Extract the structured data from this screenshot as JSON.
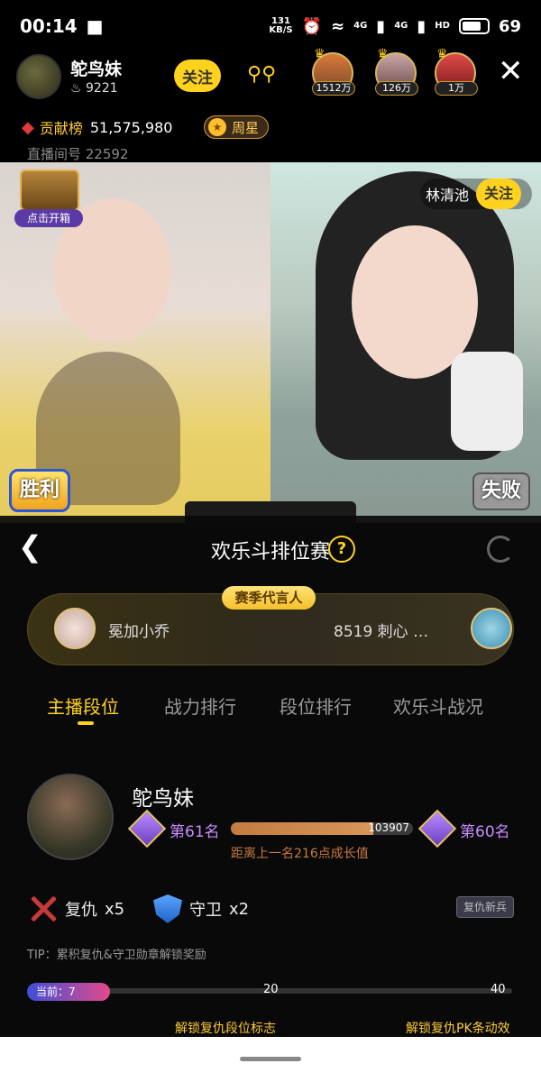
{
  "status": {
    "time": "00:14",
    "net_speed_top": "131",
    "net_speed_unit": "KB/S",
    "signal1": "4G",
    "signal2": "4G",
    "hd": "HD",
    "battery": "69"
  },
  "header": {
    "host_name": "鸵鸟妹",
    "fans": "9221",
    "follow_label": "关注",
    "viewers": [
      {
        "count": "1512万"
      },
      {
        "count": "126万"
      },
      {
        "count": "1万"
      }
    ]
  },
  "contrib": {
    "label": "贡献榜",
    "value": "51,575,980",
    "weekstar": "周星",
    "room_id": "直播间号 22592"
  },
  "video": {
    "chest_label": "点击开箱",
    "win": "胜利",
    "lose": "失败",
    "opponent_name": "林清池",
    "opponent_follow": "关注"
  },
  "panel": {
    "title": "欢乐斗排位赛",
    "spokes_label": "赛季代言人",
    "spoke_left": "冕加小乔",
    "spoke_right": "8519 刺心 …",
    "tabs": [
      "主播段位",
      "战力排行",
      "段位排行",
      "欢乐斗战况"
    ],
    "me_name": "鸵鸟妹",
    "rank_current": "第61名",
    "rank_next": "第60名",
    "progress_value": "103907",
    "progress_fraction": 0.78,
    "progress_note": "距离上一名216点成长值",
    "revenge_label": "复仇",
    "revenge_count": "x5",
    "guard_label": "守卫",
    "guard_count": "x2",
    "revenge_badge": "复仇新兵",
    "tip": "TIP：累积复仇&守卫勋章解锁奖励",
    "current_label": "当前：7",
    "marker_20": "20",
    "marker_40": "40",
    "unlock_left": "解锁复仇段位标志",
    "unlock_right": "解锁复仇PK条动效"
  }
}
